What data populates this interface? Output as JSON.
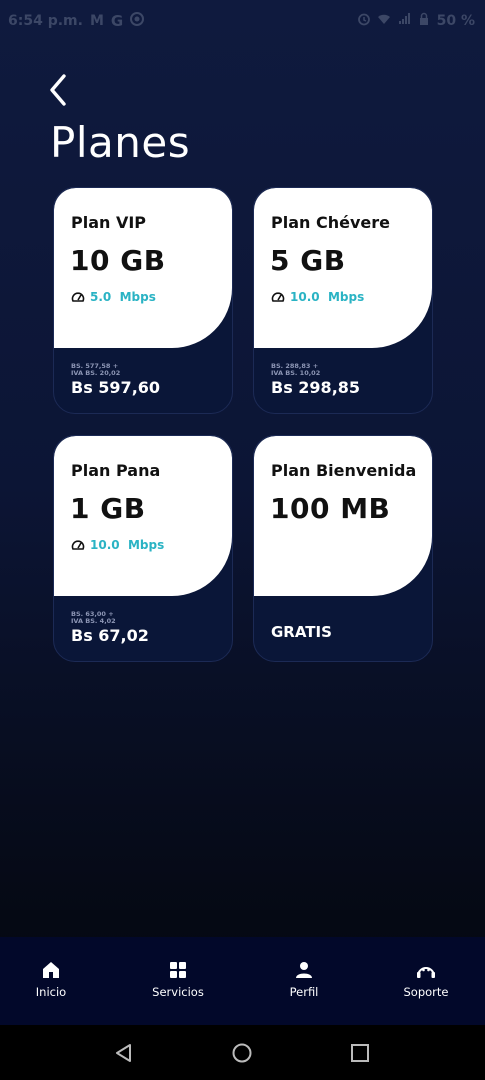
{
  "status_bar": {
    "time": "6:54 p.m.",
    "battery": "50 %",
    "icons": [
      "gmail-icon",
      "google-icon",
      "globe-icon",
      "alarm-icon",
      "wifi-icon",
      "signal-icon",
      "lock-icon"
    ]
  },
  "header": {
    "back_icon": "chevron-left-icon",
    "title": "Planes"
  },
  "plans": [
    {
      "name": "Plan VIP",
      "data": "10 GB",
      "speed": "5.0  Mbps",
      "base": "BS. 577,58 +",
      "iva": "IVA BS. 20,02",
      "price": "Bs 597,60"
    },
    {
      "name": "Plan Chévere",
      "data": "5 GB",
      "speed": "10.0  Mbps",
      "base": "BS. 288,83 +",
      "iva": "IVA BS. 10,02",
      "price": "Bs 298,85"
    },
    {
      "name": "Plan Pana",
      "data": "1 GB",
      "speed": "10.0  Mbps",
      "base": "BS. 63,00 +",
      "iva": "IVA BS. 4,02",
      "price": "Bs 67,02"
    },
    {
      "name": "Plan Bienvenida",
      "data": "100 MB",
      "free_label": "GRATIS"
    }
  ],
  "bottom_nav": [
    {
      "label": "Inicio",
      "icon": "home-icon"
    },
    {
      "label": "Servicios",
      "icon": "grid-icon"
    },
    {
      "label": "Perfil",
      "icon": "person-icon"
    },
    {
      "label": "Soporte",
      "icon": "support-icon"
    }
  ],
  "colors": {
    "background_top": "#0f1a3e",
    "background_bottom": "#03060f",
    "card_bottom": "#0a1638",
    "speed_accent": "#2ab3c4",
    "nav_bar": "#02082a"
  }
}
